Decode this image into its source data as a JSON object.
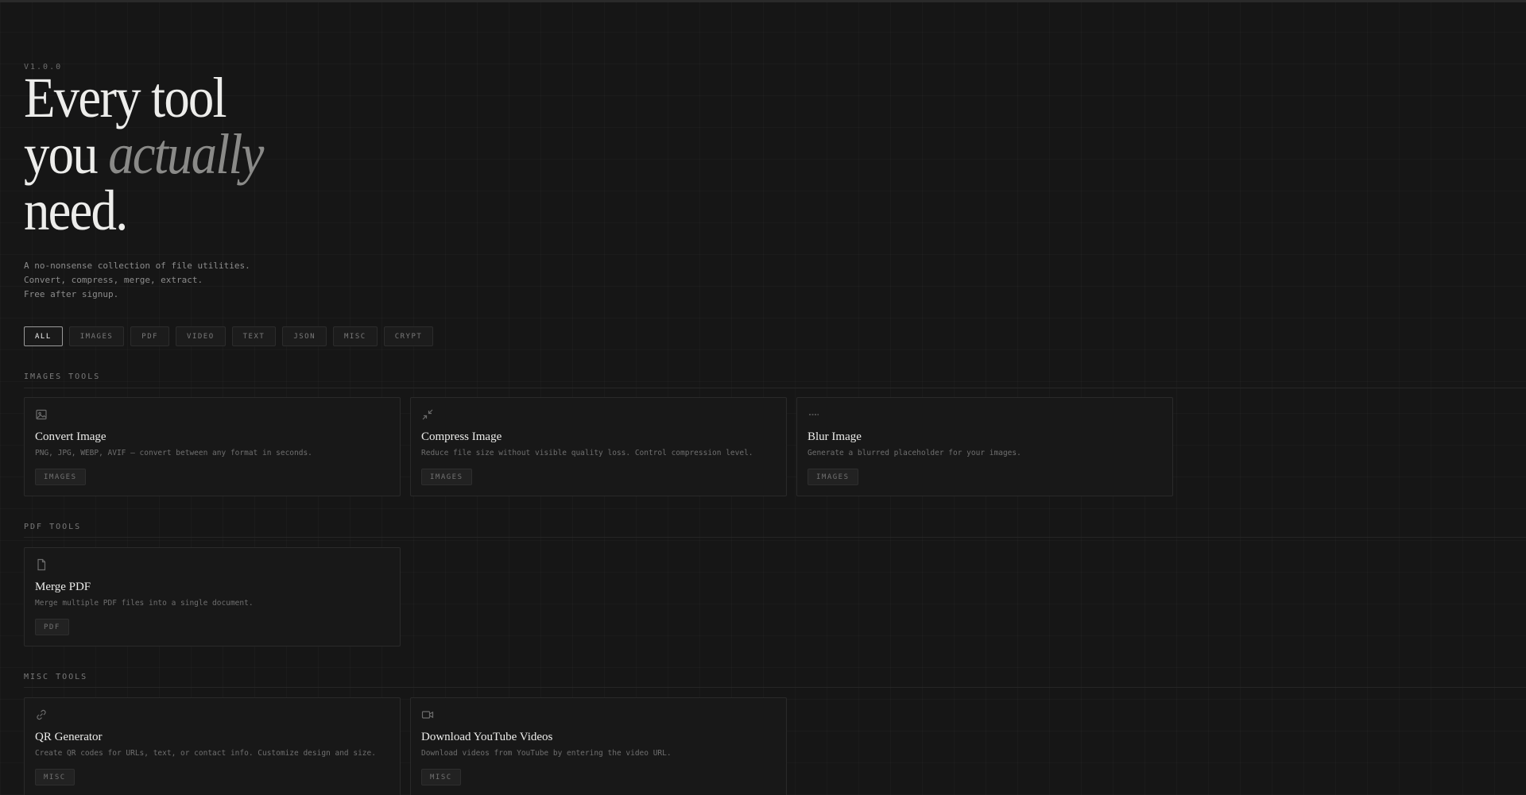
{
  "hero": {
    "version": "V1.0.0",
    "headline_line1": "Every tool",
    "headline_line2_prefix": "you ",
    "headline_line2_emphasis": "actually",
    "headline_line3": "need.",
    "tagline_lines": [
      "A no-nonsense collection of file utilities.",
      "Convert, compress, merge, extract.",
      "Free after signup."
    ]
  },
  "filters": [
    {
      "label": "ALL",
      "active": true
    },
    {
      "label": "IMAGES",
      "active": false
    },
    {
      "label": "PDF",
      "active": false
    },
    {
      "label": "VIDEO",
      "active": false
    },
    {
      "label": "TEXT",
      "active": false
    },
    {
      "label": "JSON",
      "active": false
    },
    {
      "label": "MISC",
      "active": false
    },
    {
      "label": "CRYPT",
      "active": false
    }
  ],
  "sections": {
    "images": {
      "label": "IMAGES TOOLS",
      "tools": [
        {
          "icon": "image-icon",
          "title": "Convert Image",
          "description": "PNG, JPG, WEBP, AVIF — convert between any format in seconds.",
          "tag": "IMAGES"
        },
        {
          "icon": "compress-arrows-icon",
          "title": "Compress Image",
          "description": "Reduce file size without visible quality loss. Control compression level.",
          "tag": "IMAGES"
        },
        {
          "icon": "blur-lines-icon",
          "title": "Blur Image",
          "description": "Generate a blurred placeholder for your images.",
          "tag": "IMAGES"
        }
      ]
    },
    "pdf": {
      "label": "PDF TOOLS",
      "tools": [
        {
          "icon": "file-icon",
          "title": "Merge PDF",
          "description": "Merge multiple PDF files into a single document.",
          "tag": "PDF"
        }
      ]
    },
    "misc": {
      "label": "MISC TOOLS",
      "tools": [
        {
          "icon": "link-icon",
          "title": "QR Generator",
          "description": "Create QR codes for URLs, text, or contact info. Customize design and size.",
          "tag": "MISC"
        },
        {
          "icon": "video-camera-icon",
          "title": "Download YouTube Videos",
          "description": "Download videos from YouTube by entering the video URL.",
          "tag": "MISC"
        }
      ]
    }
  }
}
